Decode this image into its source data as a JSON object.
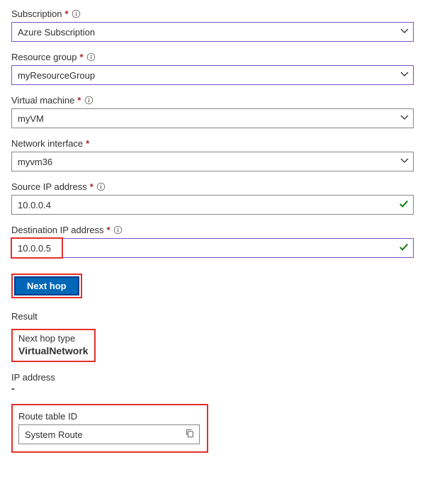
{
  "fields": {
    "subscription": {
      "label": "Subscription",
      "value": "Azure Subscription"
    },
    "resourceGroup": {
      "label": "Resource group",
      "value": "myResourceGroup"
    },
    "virtualMachine": {
      "label": "Virtual machine",
      "value": "myVM"
    },
    "networkInterface": {
      "label": "Network interface",
      "value": "myvm36"
    },
    "sourceIp": {
      "label": "Source IP address",
      "value": "10.0.0.4"
    },
    "destIp": {
      "label": "Destination IP address",
      "value": "10.0.0.5"
    }
  },
  "button": {
    "label": "Next hop"
  },
  "result": {
    "heading": "Result",
    "nextHopTypeLabel": "Next hop type",
    "nextHopTypeValue": "VirtualNetwork",
    "ipAddressLabel": "IP address",
    "ipAddressValue": "-",
    "routeTableLabel": "Route table ID",
    "routeTableValue": "System Route"
  }
}
